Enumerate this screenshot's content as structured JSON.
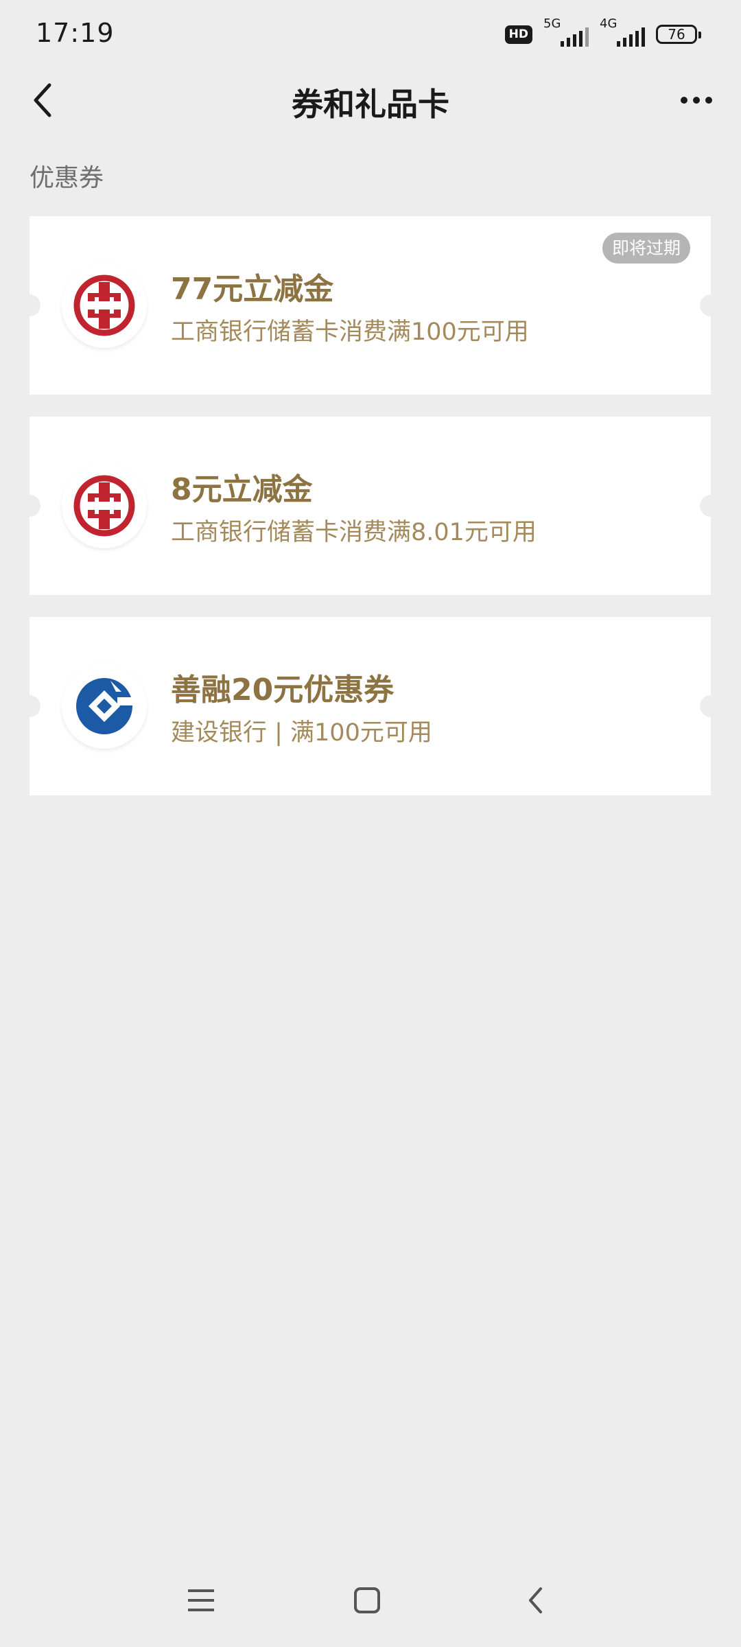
{
  "status_bar": {
    "time": "17:19",
    "hd": "HD",
    "sim1_label": "5G",
    "sim2_label": "4G",
    "battery": "76"
  },
  "header": {
    "title": "券和礼品卡",
    "back_icon": "chevron-left-icon",
    "more_icon": "more-dots-icon"
  },
  "section": {
    "title": "优惠券"
  },
  "coupons": [
    {
      "bank_logo": "icbc-logo",
      "title": "77元立减金",
      "desc": "工商银行储蓄卡消费满100元可用",
      "badge": "即将过期"
    },
    {
      "bank_logo": "icbc-logo",
      "title": "8元立减金",
      "desc": "工商银行储蓄卡消费满8.01元可用"
    },
    {
      "bank_logo": "ccb-logo",
      "title": "善融20元优惠券",
      "desc": "建设银行 | 满100元可用"
    }
  ],
  "colors": {
    "background": "#ededed",
    "coupon_title": "#8d7342",
    "coupon_desc": "#a48a5a",
    "icbc_red": "#c0252f",
    "ccb_blue": "#1d5aa6",
    "badge": "#b5b5b5"
  },
  "system_nav": {
    "menu_icon": "menu-icon",
    "home_icon": "home-icon",
    "back_icon": "back-icon"
  }
}
